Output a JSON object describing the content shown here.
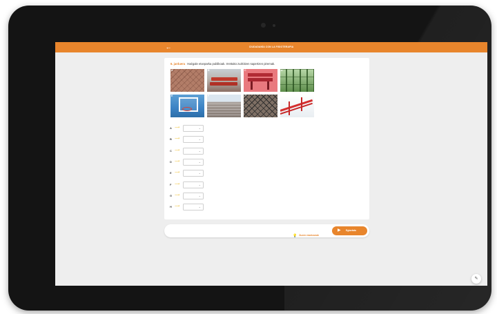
{
  "header": {
    "title": "CIUDADANÍA CON LA FISIOTERAPIA",
    "back_icon": "←"
  },
  "exercise": {
    "number": "6. jarduera",
    "instruction": "Haégale etxeparka publikoak. Irrettakü zuzkitzen sapertzen piremak."
  },
  "photos": [
    {
      "label": "A",
      "icon": "paving-tiles-photo"
    },
    {
      "label": "B",
      "icon": "red-bench-photo"
    },
    {
      "label": "C",
      "icon": "red-bench-pink-photo"
    },
    {
      "label": "D",
      "icon": "green-fence-photo"
    },
    {
      "label": "E",
      "icon": "basketball-hoop-photo"
    },
    {
      "label": "F",
      "icon": "stadium-seats-photo"
    },
    {
      "label": "G",
      "icon": "wire-mesh-photo"
    },
    {
      "label": "H",
      "icon": "red-handrail-photo"
    }
  ],
  "answers": [
    {
      "letter": "A",
      "value": ""
    },
    {
      "letter": "B",
      "value": ""
    },
    {
      "letter": "C",
      "value": ""
    },
    {
      "letter": "D",
      "value": ""
    },
    {
      "letter": "E",
      "value": ""
    },
    {
      "letter": "F",
      "value": ""
    },
    {
      "letter": "G",
      "value": ""
    },
    {
      "letter": "H",
      "value": ""
    }
  ],
  "footer": {
    "hint_label": "Zuzen erantzunak",
    "check_label": "Egiaztatu"
  },
  "colors": {
    "accent": "#e8852c",
    "arrow": "#f0c23a",
    "background": "#eeeeee"
  }
}
